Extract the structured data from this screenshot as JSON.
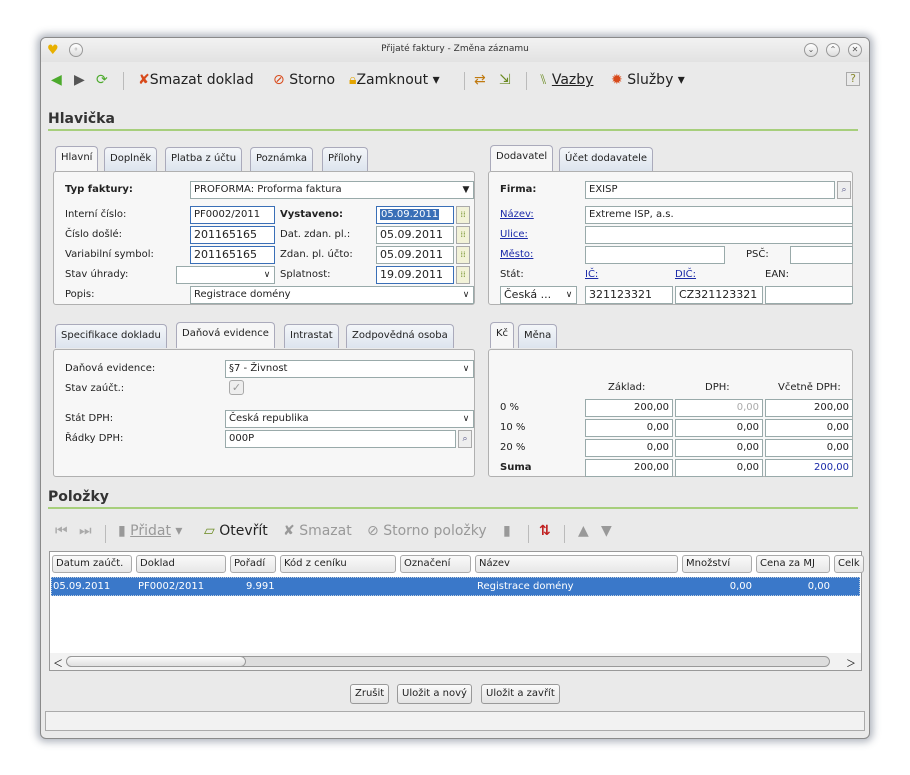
{
  "window": {
    "title": "Přijaté faktury - Změna záznamu"
  },
  "toolbar": {
    "delete": "Smazat doklad",
    "storno": "Storno",
    "lock": "Zamknout",
    "links": "Vazby",
    "services": "Služby"
  },
  "header": {
    "section_title": "Hlavička",
    "tabs": [
      "Hlavní",
      "Doplněk",
      "Platba z účtu",
      "Poznámka",
      "Přílohy"
    ],
    "fields": {
      "typ_label": "Typ faktury:",
      "typ_value": "PROFORMA: Proforma faktura",
      "interni_label": "Interní číslo:",
      "interni_value": "PF0002/2011",
      "vystaveno_label": "Vystaveno:",
      "vystaveno_value": "05.09.2011",
      "cislo_label": "Číslo došlé:",
      "cislo_value": "201165165",
      "dzp_label": "Dat. zdan. pl.:",
      "dzp_value": "05.09.2011",
      "vs_label": "Variabilní symbol:",
      "vs_value": "201165165",
      "zpu_label": "Zdan. pl. účto:",
      "zpu_value": "05.09.2011",
      "stav_label": "Stav úhrady:",
      "stav_value": "",
      "splatnost_label": "Splatnost:",
      "splatnost_value": "19.09.2011",
      "popis_label": "Popis:",
      "popis_value": "Registrace domény"
    }
  },
  "supplier": {
    "tabs": [
      "Dodavatel",
      "Účet dodavatele"
    ],
    "firma_label": "Firma:",
    "firma_value": "EXISP",
    "nazev_label": "Název:",
    "nazev_value": "Extreme ISP, a.s.",
    "ulice_label": "Ulice:",
    "ulice_value": "",
    "mesto_label": "Město:",
    "mesto_value": "",
    "psc_label": "PSČ:",
    "psc_value": "",
    "stat_label": "Stát:",
    "ic_label": "IČ:",
    "dic_label": "DIČ:",
    "ean_label": "EAN:",
    "stat_value": "Česká ...",
    "ic_value": "321123321",
    "dic_value": "CZ321123321",
    "ean_value": ""
  },
  "tax": {
    "tabs": [
      "Specifikace dokladu",
      "Daňová evidence",
      "Intrastat",
      "Zodpovědná osoba"
    ],
    "evidence_label": "Daňová evidence:",
    "evidence_value": "§7 - Živnost",
    "stav_label": "Stav zaúčt.:",
    "stat_dph_label": "Stát DPH:",
    "stat_dph_value": "Česká republika",
    "radky_label": "Řádky DPH:",
    "radky_value": "000P"
  },
  "amounts": {
    "tabs": [
      "Kč",
      "Měna"
    ],
    "cols": [
      "Základ:",
      "DPH:",
      "Včetně DPH:"
    ],
    "rows": [
      {
        "label": "0 %",
        "zaklad": "200,00",
        "dph": "0,00",
        "celkem": "200,00"
      },
      {
        "label": "10 %",
        "zaklad": "0,00",
        "dph": "0,00",
        "celkem": "0,00"
      },
      {
        "label": "20 %",
        "zaklad": "0,00",
        "dph": "0,00",
        "celkem": "0,00"
      },
      {
        "label": "Suma",
        "zaklad": "200,00",
        "dph": "0,00",
        "celkem": "200,00"
      }
    ]
  },
  "items": {
    "section_title": "Položky",
    "toolbar": {
      "add": "Přidat",
      "open": "Otevřít",
      "delete": "Smazat",
      "storno": "Storno položky"
    },
    "columns": [
      "Datum zaúčt.",
      "Doklad",
      "Pořadí",
      "Kód z ceníku",
      "Označení",
      "Název",
      "Množství",
      "Cena za MJ",
      "Celk"
    ],
    "row": {
      "datum": "05.09.2011",
      "doklad": "PF0002/2011",
      "poradi": "9.991",
      "kod": "",
      "oznaceni": "",
      "nazev": "Registrace domény",
      "mnozstvi": "0,00",
      "cena": "0,00"
    }
  },
  "buttons": {
    "cancel": "Zrušit",
    "save_new": "Uložit a nový",
    "save_close": "Uložit a zavřít"
  },
  "colors": {
    "accent_line": "#a7cf7c",
    "selection": "#3a6fb7",
    "link": "#1a2aa8"
  }
}
